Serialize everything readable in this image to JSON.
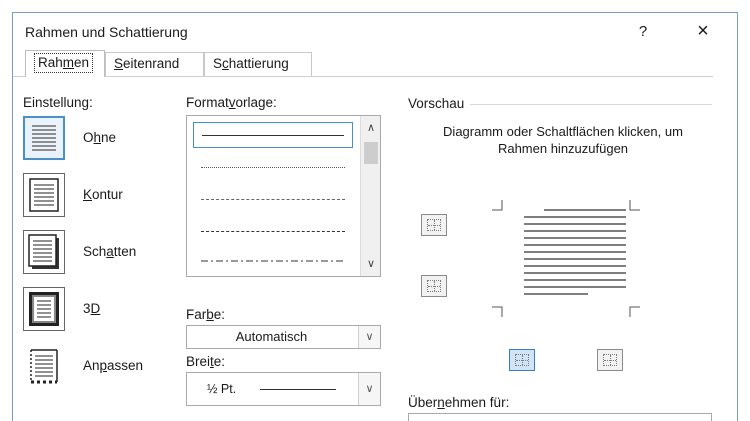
{
  "dialog": {
    "title": "Rahmen und Schattierung",
    "help_label": "?",
    "close_label": "×"
  },
  "tabs": [
    {
      "pre": "Rah",
      "u": "m",
      "post": "en",
      "active": true
    },
    {
      "pre": "",
      "u": "S",
      "post": "eitenrand",
      "active": false
    },
    {
      "pre": "S",
      "u": "c",
      "post": "hattierung",
      "active": false
    }
  ],
  "einstellung": {
    "label": "Einstellung:",
    "items": [
      {
        "pre": "O",
        "u": "h",
        "post": "ne",
        "icon": "setting-none-icon"
      },
      {
        "pre": "",
        "u": "K",
        "post": "ontur",
        "icon": "setting-box-icon"
      },
      {
        "pre": "Sch",
        "u": "a",
        "post": "tten",
        "icon": "setting-shadow-icon"
      },
      {
        "pre": "3",
        "u": "D",
        "post": "",
        "icon": "setting-3d-icon"
      },
      {
        "pre": "An",
        "u": "p",
        "post": "assen",
        "icon": "setting-custom-icon"
      }
    ]
  },
  "formatvorlage": {
    "label_pre": "Format",
    "label_u": "v",
    "label_post": "orlage:",
    "styles": [
      "solid",
      "dotted",
      "dashed-fine",
      "dashed",
      "dash-dot"
    ]
  },
  "farbe": {
    "label_pre": "Far",
    "label_u": "b",
    "label_post": "e:",
    "value": "Automatisch"
  },
  "breite": {
    "label_pre": "Brei",
    "label_u": "t",
    "label_post": "e:",
    "value": "½ Pt."
  },
  "vorschau": {
    "label": "Vorschau",
    "instructions": "Diagramm oder Schaltflächen klicken, um Rahmen hinzuzufügen"
  },
  "uebernehmen": {
    "label_pre": "Über",
    "label_u": "n",
    "label_post": "ehmen für:"
  },
  "colors": {
    "accent": "#4a90c8",
    "dialog_border": "#7a9cc6"
  }
}
